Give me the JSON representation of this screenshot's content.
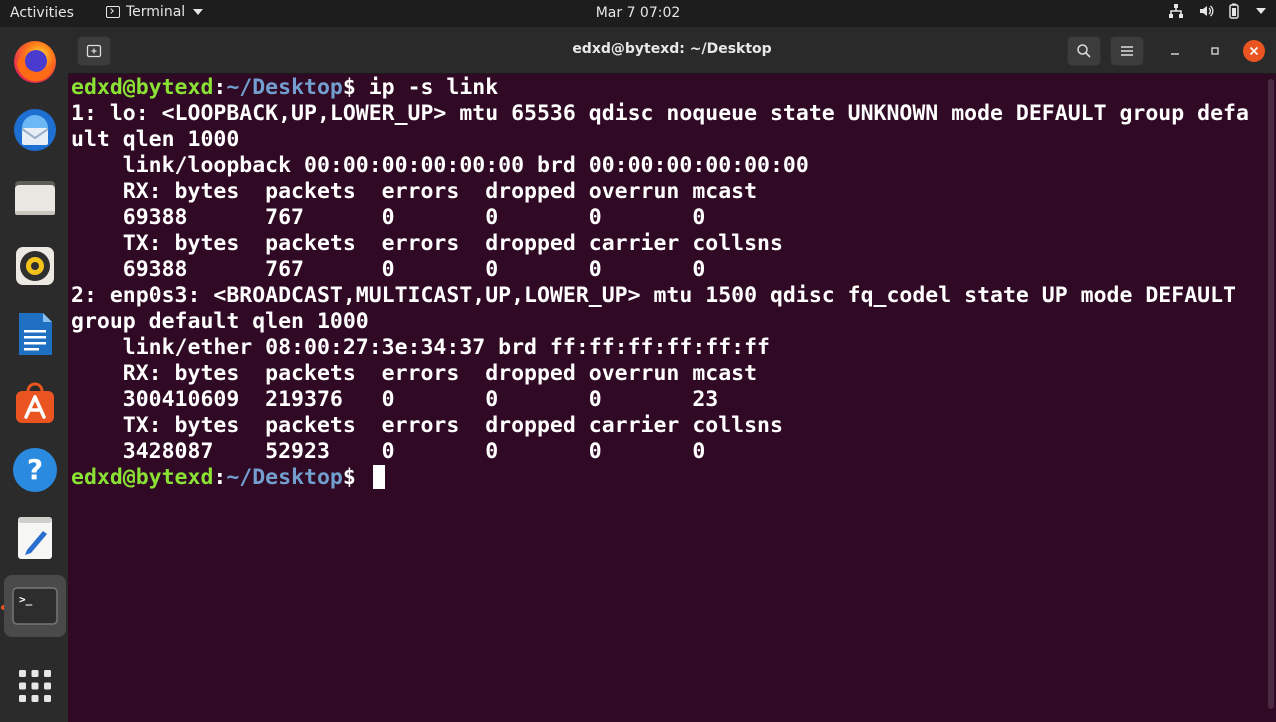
{
  "topbar": {
    "activities": "Activities",
    "app_menu": "Terminal",
    "clock": "Mar 7  07:02"
  },
  "dock": {
    "items": [
      {
        "name": "Firefox",
        "icon": "firefox-icon"
      },
      {
        "name": "Thunderbird",
        "icon": "thunderbird-icon"
      },
      {
        "name": "Files",
        "icon": "files-icon"
      },
      {
        "name": "Rhythmbox",
        "icon": "rhythmbox-icon"
      },
      {
        "name": "LibreOffice Writer",
        "icon": "writer-icon"
      },
      {
        "name": "Ubuntu Software",
        "icon": "software-icon"
      },
      {
        "name": "Help",
        "icon": "help-icon"
      },
      {
        "name": "Text Editor",
        "icon": "text-editor-icon"
      },
      {
        "name": "Terminal",
        "icon": "terminal-icon"
      },
      {
        "name": "Show Applications",
        "icon": "app-grid-icon"
      }
    ],
    "help_glyph": "?",
    "terminal_glyph": ">_"
  },
  "window": {
    "title": "edxd@bytexd: ~/Desktop"
  },
  "terminal": {
    "prompt_user": "edxd@bytexd",
    "prompt_sep": ":",
    "prompt_path": "~/Desktop",
    "prompt_dollar": "$ ",
    "command": "ip -s link",
    "output": [
      "1: lo: <LOOPBACK,UP,LOWER_UP> mtu 65536 qdisc noqueue state UNKNOWN mode DEFAULT group defa",
      "ult qlen 1000",
      "    link/loopback 00:00:00:00:00:00 brd 00:00:00:00:00:00",
      "    RX: bytes  packets  errors  dropped overrun mcast",
      "    69388      767      0       0       0       0",
      "    TX: bytes  packets  errors  dropped carrier collsns",
      "    69388      767      0       0       0       0",
      "2: enp0s3: <BROADCAST,MULTICAST,UP,LOWER_UP> mtu 1500 qdisc fq_codel state UP mode DEFAULT",
      "group default qlen 1000",
      "    link/ether 08:00:27:3e:34:37 brd ff:ff:ff:ff:ff:ff",
      "    RX: bytes  packets  errors  dropped overrun mcast",
      "    300410609  219376   0       0       0       23",
      "    TX: bytes  packets  errors  dropped carrier collsns",
      "    3428087    52923    0       0       0       0"
    ]
  },
  "colors": {
    "terminal_bg": "#300a24",
    "prompt_user": "#8ae234",
    "prompt_path": "#729fcf",
    "close_button": "#e95420"
  }
}
